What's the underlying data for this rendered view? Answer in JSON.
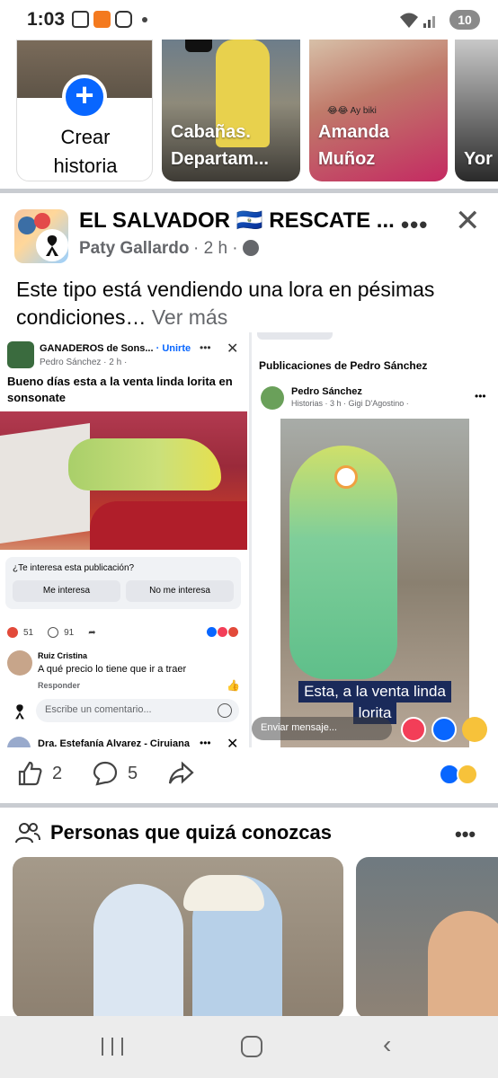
{
  "status_bar": {
    "time": "1:03",
    "battery": "10"
  },
  "stories": {
    "create_label": "Crear historia",
    "items": [
      {
        "label": "Cabañas. Departam..."
      },
      {
        "label": "Amanda Muñoz",
        "sticker": "😂😂 Ay biki"
      },
      {
        "label": "Yor"
      }
    ]
  },
  "post": {
    "group_name": "EL SALVADOR 🇸🇻 RESCATE ...",
    "author": "Paty Gallardo",
    "time": "· 2 h ·",
    "text": "Este tipo está vendiendo una lora en pésimas condiciones…",
    "see_more": "Ver más",
    "reactions": {
      "likes": "2",
      "comments": "5"
    }
  },
  "left_shot": {
    "group": "GANADEROS  de Sons...",
    "join": "· Unirte",
    "author": "Pedro Sánchez",
    "time": "· 2 h ·",
    "caption": "Bueno días esta a la venta linda lorita en sonsonate",
    "interest_question": "¿Te interesa esta publicación?",
    "btn_yes": "Me interesa",
    "btn_no": "No me interesa",
    "reaction_count": "51",
    "comment_count": "91",
    "commenter": "Ruiz Cristina",
    "comment": "A qué precio lo tiene que ir a traer",
    "reply": "Responder",
    "comment_placeholder": "Escribe un comentario...",
    "next_author": "Dra. Estefanía Alvarez - Ciruiana"
  },
  "right_shot": {
    "header": "Publicaciones de Pedro Sánchez",
    "author": "Pedro Sánchez",
    "sub": "Historias · 3 h · Gigi D'Agostino · ",
    "caption_line1": "Esta, a la venta linda",
    "caption_line2": "lorita",
    "message_placeholder": "Enviar mensaje..."
  },
  "people": {
    "title": "Personas que quizá conozcas"
  },
  "colors": {
    "accent": "#0866ff",
    "text": "#050505",
    "secondary": "#65676b",
    "divider": "#c9ccd1"
  }
}
